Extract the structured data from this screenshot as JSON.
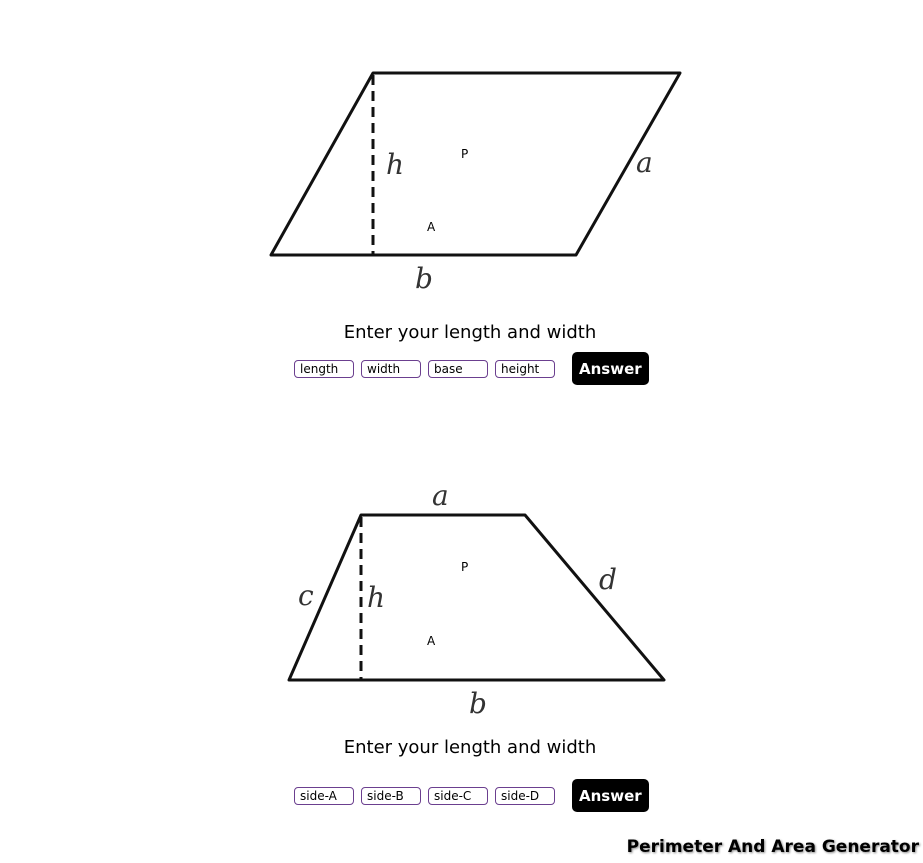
{
  "parallelogram": {
    "labels": {
      "h": "h",
      "a": "a",
      "b": "b"
    },
    "perimeter_marker": "P",
    "area_marker": "A",
    "prompt": "Enter your length and width",
    "inputs": [
      {
        "placeholder": "length",
        "value": ""
      },
      {
        "placeholder": "width",
        "value": ""
      },
      {
        "placeholder": "base",
        "value": ""
      },
      {
        "placeholder": "height",
        "value": ""
      }
    ],
    "answer_label": "Answer"
  },
  "trapezoid": {
    "labels": {
      "a": "a",
      "b": "b",
      "c": "c",
      "d": "d",
      "h": "h"
    },
    "perimeter_marker": "P",
    "area_marker": "A",
    "prompt": "Enter your length and width",
    "inputs": [
      {
        "placeholder": "side-A",
        "value": ""
      },
      {
        "placeholder": "side-B",
        "value": ""
      },
      {
        "placeholder": "side-C",
        "value": ""
      },
      {
        "placeholder": "side-D",
        "value": ""
      }
    ],
    "answer_label": "Answer"
  },
  "footer": {
    "title": "Perimeter And Area Generator"
  }
}
